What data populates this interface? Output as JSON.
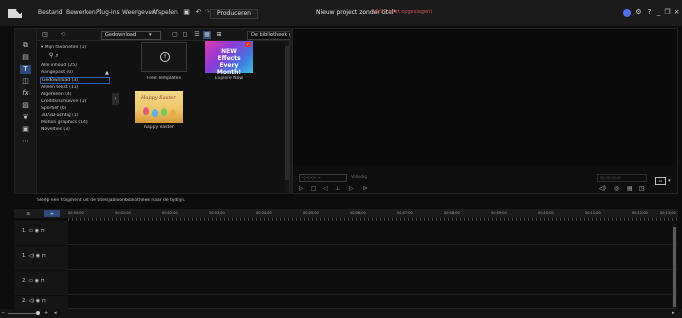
{
  "menubar": {
    "items": [
      "Bestand",
      "Bewerken",
      "Plug-ins",
      "Weergeven",
      "Afspelen"
    ],
    "produce_label": "Produceren",
    "project_title": "Nieuw project zonder titel*",
    "project_status": "16:9 | (niet opgeslagen)",
    "window_controls": [
      "?",
      "_",
      "❐",
      "×"
    ]
  },
  "library": {
    "dropdown_value": "Gedownload",
    "dropdown_caret": "▾",
    "search_placeholder": "De bibliotheek doorzoeken",
    "favorites_label": "Mijn favorieten (1)",
    "collapse_caret": "▲",
    "categories": [
      "Alle inhoud (25)",
      "Aangepast (0)",
      "Gedownload (3)",
      "Alleen tekst (11)",
      "Algemeen (4)",
      "Credits/schuiven (1)",
      "Sportief (6)",
      "3D/3D-achtig (1)",
      "Motion graphics (14)",
      "Novelties (3)"
    ],
    "selected_category_index": 2,
    "items": [
      {
        "label": "Free Templates",
        "icon": "↑"
      },
      {
        "label": "Explore Now",
        "thumb_text": "NEW Effects Every Month!",
        "badge": "✓"
      },
      {
        "label": "happy easter",
        "thumb_text": "Happy Easter"
      }
    ]
  },
  "preview": {
    "timecode": "--;--;--;--  --",
    "quality": "Volledig",
    "field_placeholder": "00;00;00;00"
  },
  "hint_text": "Sleep een fragment uit de titelsjabloonbibliotheek naar de tijdlijn.",
  "timeline": {
    "ruler_labels": [
      "00;00;00",
      "00;01;00",
      "00;02;00",
      "00;03;00",
      "00;04;00",
      "00;05;00",
      "00;06;00",
      "00;07;00",
      "00;08;00",
      "00;09;00",
      "00;10;00",
      "00;11;00",
      "00;12;00",
      "00;13;00"
    ],
    "tracks": [
      {
        "label": "1.",
        "type": "video"
      },
      {
        "label": "1.",
        "type": "audio"
      },
      {
        "label": "2.",
        "type": "video"
      },
      {
        "label": "2.",
        "type": "audio"
      }
    ]
  },
  "bottombar": {
    "zoom_minus": "−",
    "zoom_plus": "+",
    "scroll_left": "◂",
    "scroll_right": "▸"
  }
}
